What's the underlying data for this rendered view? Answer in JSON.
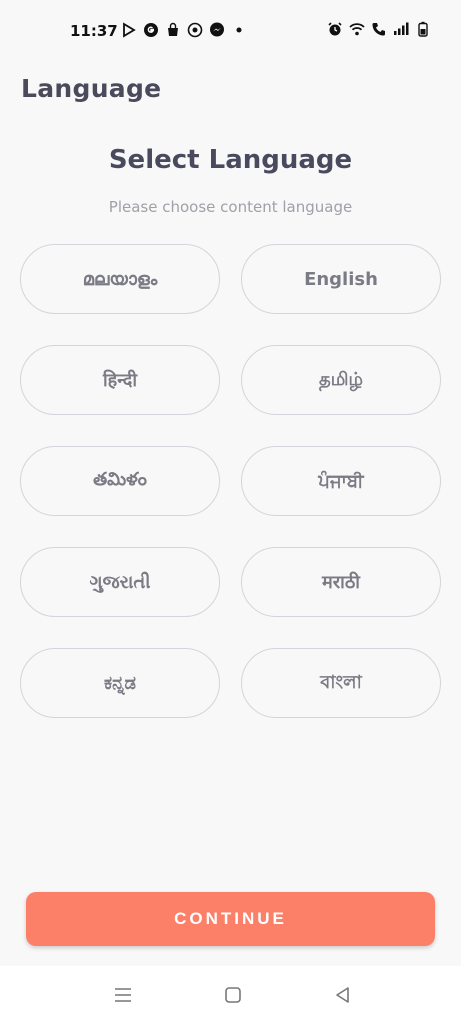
{
  "status_bar": {
    "time": "11:37",
    "left_icons": [
      "play-store-icon",
      "g-icon",
      "bag-icon",
      "camera-icon",
      "messenger-icon",
      "dot-icon"
    ],
    "right_icons": [
      "alarm-icon",
      "wifi-icon",
      "call-icon",
      "signal-icon",
      "battery-icon"
    ]
  },
  "header": {
    "title": "Language"
  },
  "content": {
    "title": "Select Language",
    "subtitle": "Please choose content language",
    "languages": [
      {
        "label": "മലയാളം"
      },
      {
        "label": "English"
      },
      {
        "label": "हिन्दी"
      },
      {
        "label": "தமிழ்"
      },
      {
        "label": "తమిళం"
      },
      {
        "label": "ਪੰਜਾਬੀ"
      },
      {
        "label": "ગુજરાતી"
      },
      {
        "label": "मराठी"
      },
      {
        "label": "ಕನ್ನಡ"
      },
      {
        "label": "বাংলা"
      }
    ]
  },
  "footer": {
    "continue_label": "CONTINUE"
  },
  "nav_bar": {
    "icons": [
      "menu-icon",
      "home-icon",
      "back-icon"
    ]
  },
  "colors": {
    "accent": "#fc8068",
    "border": "#d4d4dc",
    "title": "#4a4a5f"
  }
}
